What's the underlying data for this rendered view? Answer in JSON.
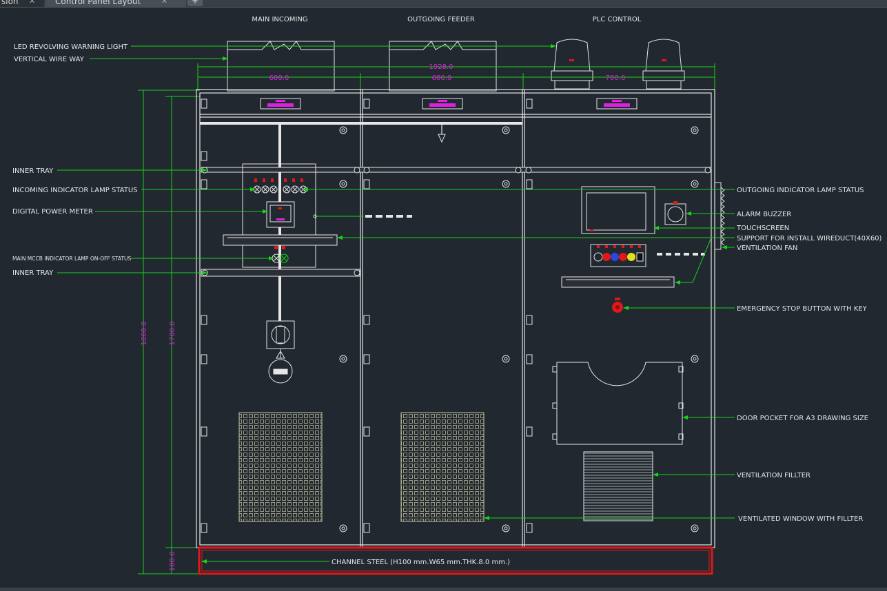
{
  "tabs": [
    {
      "label": "sion",
      "close": "✕"
    },
    {
      "label": "Control Panel Layout",
      "close": "✕"
    }
  ],
  "new_tab": "+",
  "sections": {
    "main_incoming": "MAIN INCOMING",
    "outgoing_feeder": "OUTGOING FEEDER",
    "plc_control": "PLC CONTROL"
  },
  "dimensions": {
    "total_width": "1928.0",
    "width_left": "600.0",
    "width_mid": "600.0",
    "width_right": "700.0",
    "height_total": "1800.0",
    "height_body": "1700.0",
    "height_base": "100.0"
  },
  "labels_left": {
    "led_light": "LED REVOLVING WARNING LIGHT",
    "wire_way": "VERTICAL WIRE WAY",
    "inner_tray_1": "INNER TRAY",
    "incoming_lamp": "INCOMING INDICATOR LAMP STATUS",
    "power_meter": "DIGITAL POWER METER",
    "mccb_lamp": "MAIN MCCB INDICATOR LAMP ON-OFF STATUS",
    "inner_tray_2": "INNER TRAY"
  },
  "labels_right": {
    "outgoing_lamp": "OUTGOING INDICATOR LAMP STATUS",
    "alarm_buzzer": "ALARM BUZZER",
    "touchscreen": "TOUCHSCREEN",
    "support_wireduct": "SUPPORT FOR INSTALL WIREDUCT(40X60)",
    "ventilation_fan": "VENTILATION FAN",
    "emergency_stop": "EMERGENCY STOP BUTTON WITH KEY",
    "door_pocket": "DOOR POCKET FOR A3 DRAWING SIZE",
    "vent_filter": "VENTILATION FILLTER",
    "vent_window": "VENTILATED WINDOW WITH FILLTER"
  },
  "channel_steel": "CHANNEL STEEL (H100 mm.W65 mm.THK.8.0 mm.)",
  "colors": {
    "background": "#212830",
    "outline": "#e6e6e6",
    "leader": "#19d219",
    "dimension_text": "#e020e0",
    "base_frame": "#e01818",
    "mesh": "#c8c8a0"
  }
}
